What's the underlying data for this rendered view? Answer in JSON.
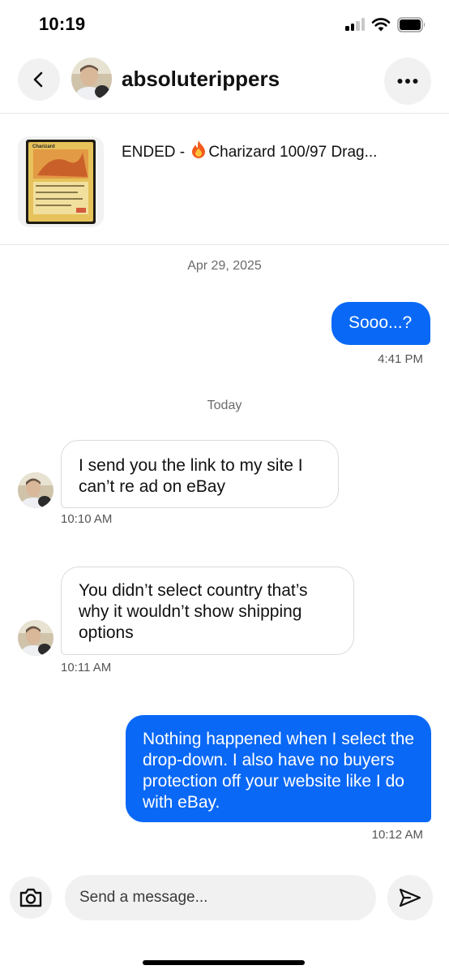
{
  "status_bar": {
    "time": "10:19"
  },
  "header": {
    "username": "absoluterippers"
  },
  "listing": {
    "title_prefix": "ENDED - ",
    "title_rest": "Charizard 100/97 Drag...",
    "card_name": "Charizard"
  },
  "conversation": {
    "date_1": "Apr 29, 2025",
    "msg_1": {
      "text": "Sooo...?",
      "time": "4:41 PM",
      "direction": "outgoing"
    },
    "date_2": "Today",
    "msg_2": {
      "text": "I send you the link to my site I can’t re ad on eBay",
      "time": "10:10 AM",
      "direction": "incoming"
    },
    "msg_3": {
      "text": "You didn’t select country that’s why it wouldn’t show shipping options",
      "time": "10:11 AM",
      "direction": "incoming"
    },
    "msg_4": {
      "text": "Nothing happened when I select the drop-down. I also have no buyers protection off your website like I do with eBay.",
      "time": "10:12 AM",
      "direction": "outgoing"
    }
  },
  "composer": {
    "placeholder": "Send a message..."
  },
  "colors": {
    "outgoing_bubble": "#0968f6",
    "accent": "#0968f6",
    "background": "#ffffff"
  }
}
